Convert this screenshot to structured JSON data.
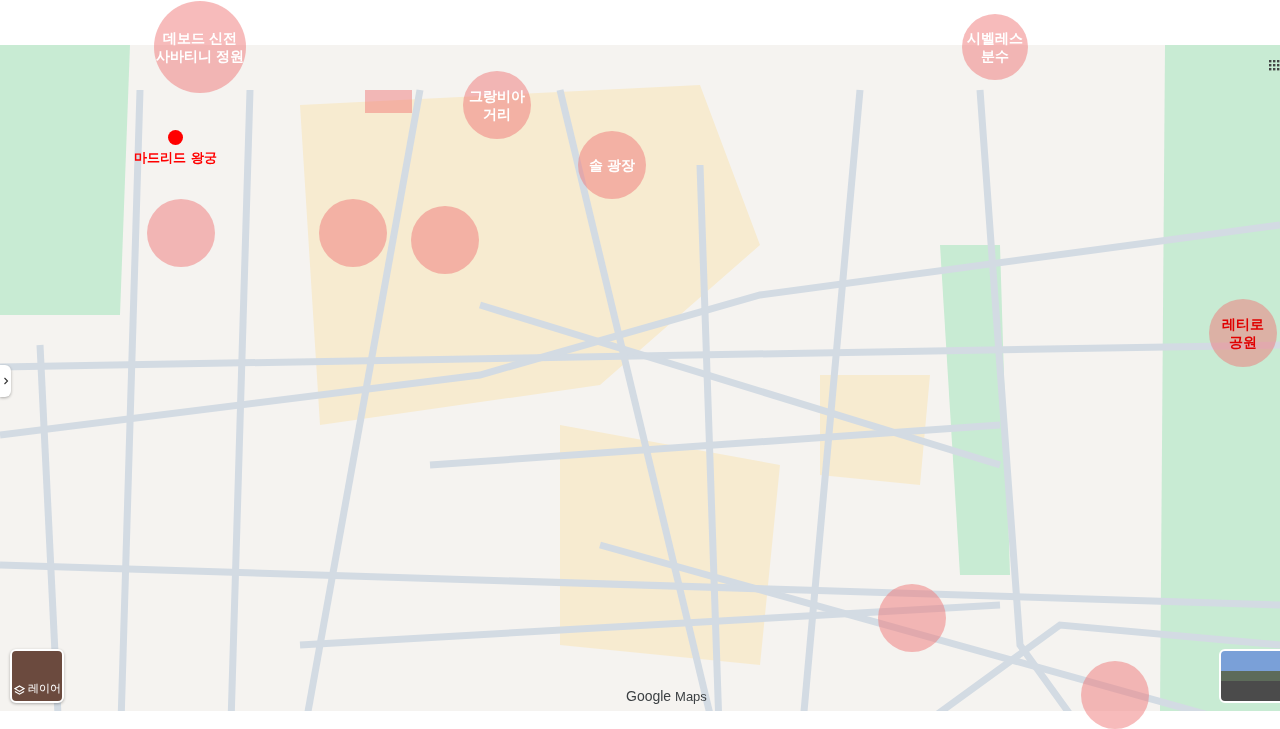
{
  "map": {
    "overlays": [
      {
        "kind": "white-text",
        "lines": [
          "데보드 신전",
          "사바티니 정원"
        ]
      },
      {
        "kind": "white-text",
        "lines": [
          "그랑비아",
          "거리"
        ]
      },
      {
        "kind": "white-text",
        "lines": [
          "솔 광장"
        ]
      },
      {
        "kind": "plain"
      },
      {
        "kind": "plain"
      },
      {
        "kind": "plain"
      },
      {
        "kind": "white-text",
        "lines": [
          "시벨레스",
          "분수"
        ]
      },
      {
        "kind": "red-text",
        "lines": [
          "레티로",
          "공원"
        ]
      },
      {
        "kind": "plain"
      },
      {
        "kind": "plain"
      }
    ],
    "marker": {
      "label": "마드리드 왕궁"
    },
    "layers_button": {
      "label": "레이어"
    },
    "logo": {
      "brand": "Google",
      "product": "Maps"
    }
  }
}
